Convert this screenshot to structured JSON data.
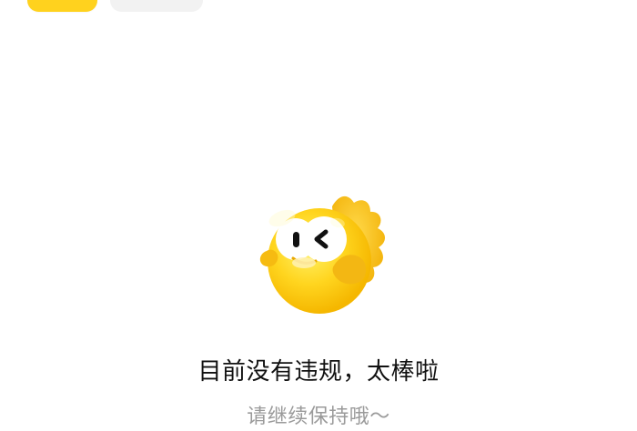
{
  "top_tabs": {
    "active_tab": {
      "label": "",
      "color": "#ffd21e"
    },
    "inactive_tab": {
      "label": "",
      "color": "#f2f2f2"
    }
  },
  "empty_state": {
    "mascot": {
      "icon": "yellow-pufferfish-mascot-icon"
    },
    "title": "目前没有违规，太棒啦",
    "subtitle": "请继续保持哦～"
  }
}
